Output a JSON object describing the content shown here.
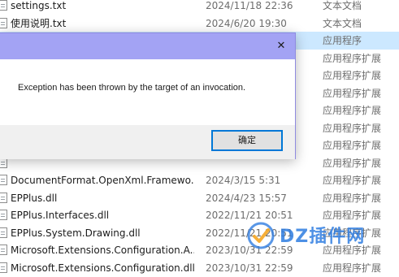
{
  "files": [
    {
      "name": "settings.txt",
      "date": "2024/11/18 22:36",
      "type": "文本文档",
      "selected": false
    },
    {
      "name": "使用说明.txt",
      "date": "2024/6/20 19:30",
      "type": "文本文档",
      "selected": false
    },
    {
      "name": "",
      "date": "",
      "type": "应用程序",
      "selected": true
    },
    {
      "name": "",
      "date": "",
      "type": "应用程序扩展",
      "selected": false
    },
    {
      "name": "",
      "date": "",
      "type": "应用程序扩展",
      "selected": false
    },
    {
      "name": "",
      "date": "",
      "type": "应用程序扩展",
      "selected": false
    },
    {
      "name": "",
      "date": "",
      "type": "应用程序扩展",
      "selected": false
    },
    {
      "name": "",
      "date": "",
      "type": "应用程序扩展",
      "selected": false
    },
    {
      "name": "",
      "date": "",
      "type": "应用程序扩展",
      "selected": false
    },
    {
      "name": "",
      "date": "",
      "type": "应用程序扩展",
      "selected": false
    },
    {
      "name": "DocumentFormat.OpenXml.Framewo...",
      "date": "2024/3/15 5:31",
      "type": "应用程序扩展",
      "selected": false
    },
    {
      "name": "EPPlus.dll",
      "date": "2024/4/23 15:57",
      "type": "应用程序扩展",
      "selected": false
    },
    {
      "name": "EPPlus.Interfaces.dll",
      "date": "2022/11/21 20:51",
      "type": "应用程序扩展",
      "selected": false
    },
    {
      "name": "EPPlus.System.Drawing.dll",
      "date": "2022/11/21 20:51",
      "type": "应用程序扩展",
      "selected": false
    },
    {
      "name": "Microsoft.Extensions.Configuration.A...",
      "date": "2023/10/31 22:59",
      "type": "应用程序扩展",
      "selected": false
    },
    {
      "name": "Microsoft.Extensions.Configuration.dll",
      "date": "2023/10/31 22:59",
      "type": "应用程序扩展",
      "selected": false
    }
  ],
  "dialog": {
    "title": "",
    "close_glyph": "✕",
    "message": "Exception has been thrown by the target of an invocation.",
    "ok_label": "确定"
  },
  "watermark": {
    "text": "DZ插件网",
    "logo_color": "#2f7de1"
  }
}
